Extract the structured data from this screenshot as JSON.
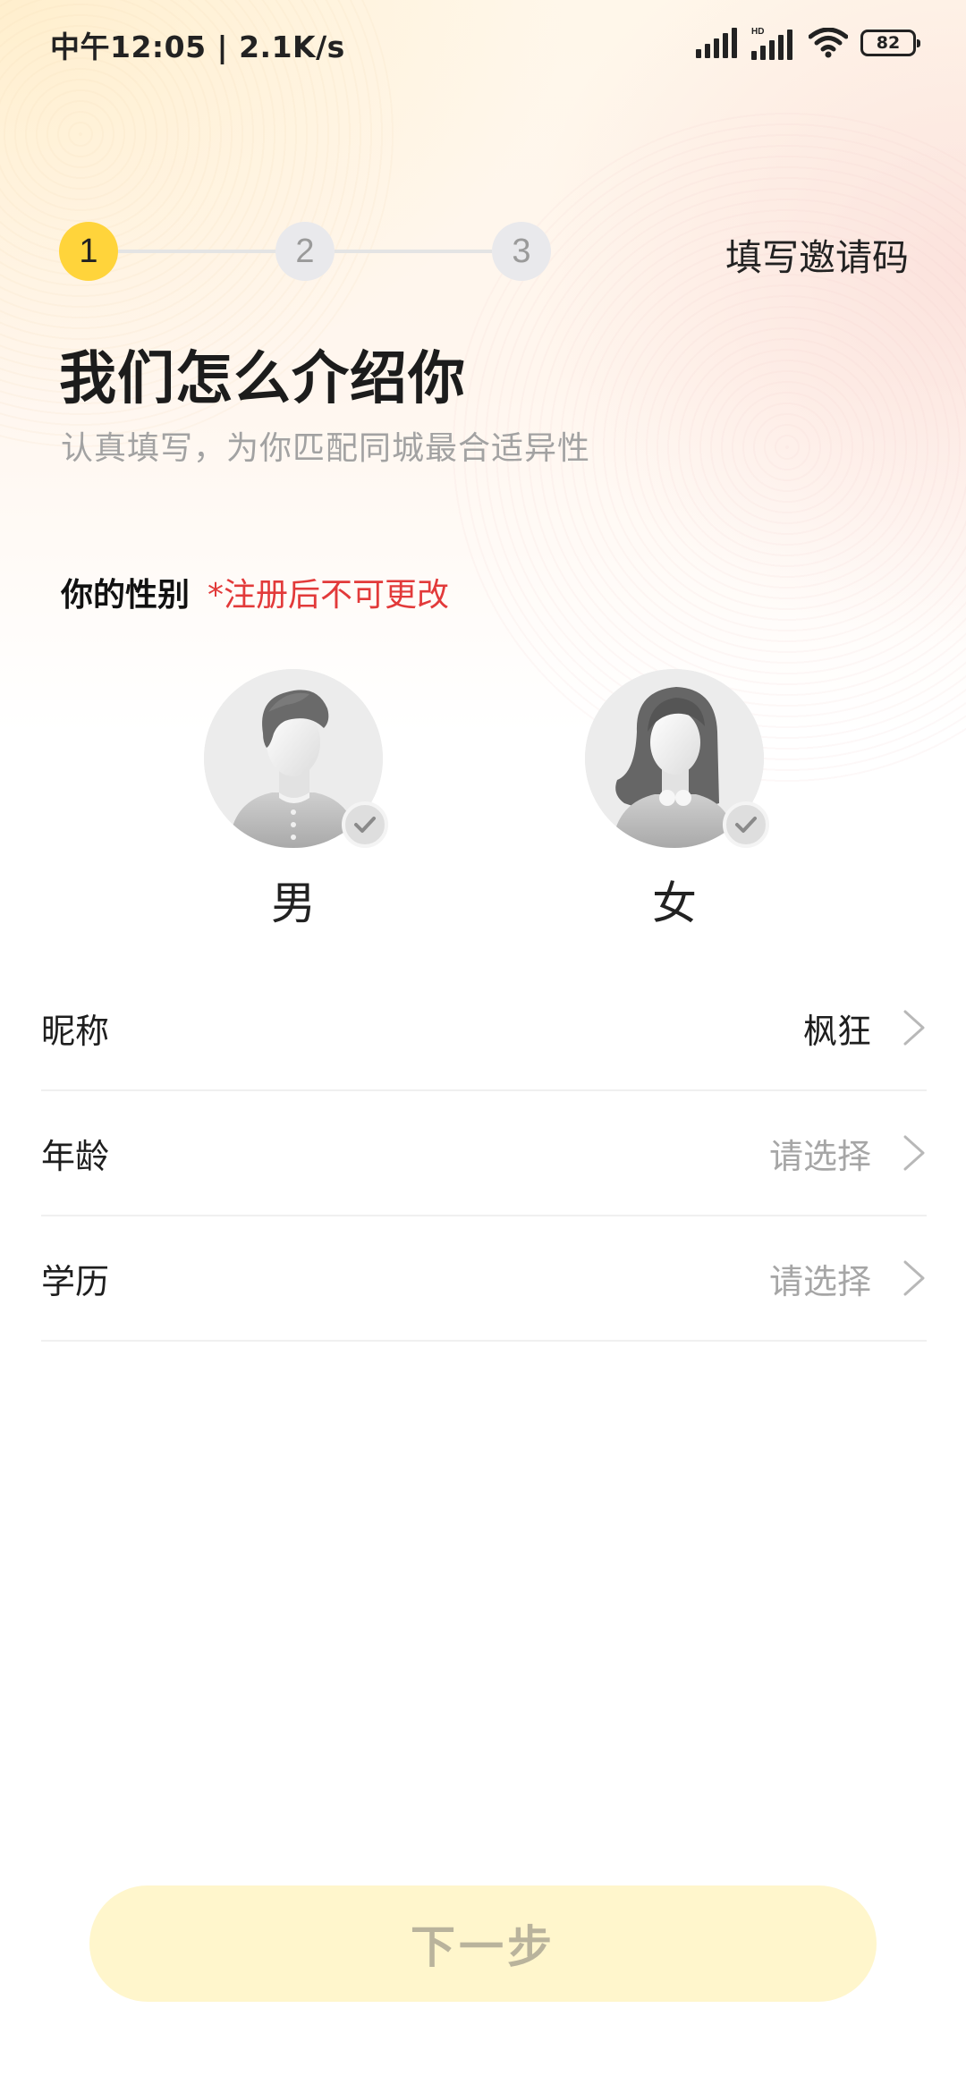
{
  "status_bar": {
    "time": "中午12:05 | 2.1K/s",
    "signal_icons": [
      "cellular-signal-icon",
      "hd-cellular-signal-icon",
      "wifi-icon",
      "battery-icon"
    ],
    "battery_level": "82"
  },
  "stepper": {
    "steps": [
      {
        "label": "1",
        "state": "active"
      },
      {
        "label": "2",
        "state": "inactive"
      },
      {
        "label": "3",
        "state": "inactive"
      }
    ],
    "invite_code_link": "填写邀请码"
  },
  "header": {
    "title": "我们怎么介绍你",
    "subtitle": "认真填写，为你匹配同城最合适异性"
  },
  "gender": {
    "label": "你的性别",
    "note": "*注册后不可更改",
    "options": [
      {
        "label": "男",
        "icon": "male-avatar-icon"
      },
      {
        "label": "女",
        "icon": "female-avatar-icon"
      }
    ]
  },
  "form": {
    "rows": [
      {
        "label": "昵称",
        "value": "枫狂",
        "is_placeholder": false
      },
      {
        "label": "年龄",
        "value": "请选择",
        "is_placeholder": true
      },
      {
        "label": "学历",
        "value": "请选择",
        "is_placeholder": true
      }
    ]
  },
  "footer": {
    "next_label": "下一步"
  },
  "colors": {
    "accent": "#ffd43b",
    "warning": "#e23a3a",
    "button_disabled_bg": "#fff6cc"
  }
}
